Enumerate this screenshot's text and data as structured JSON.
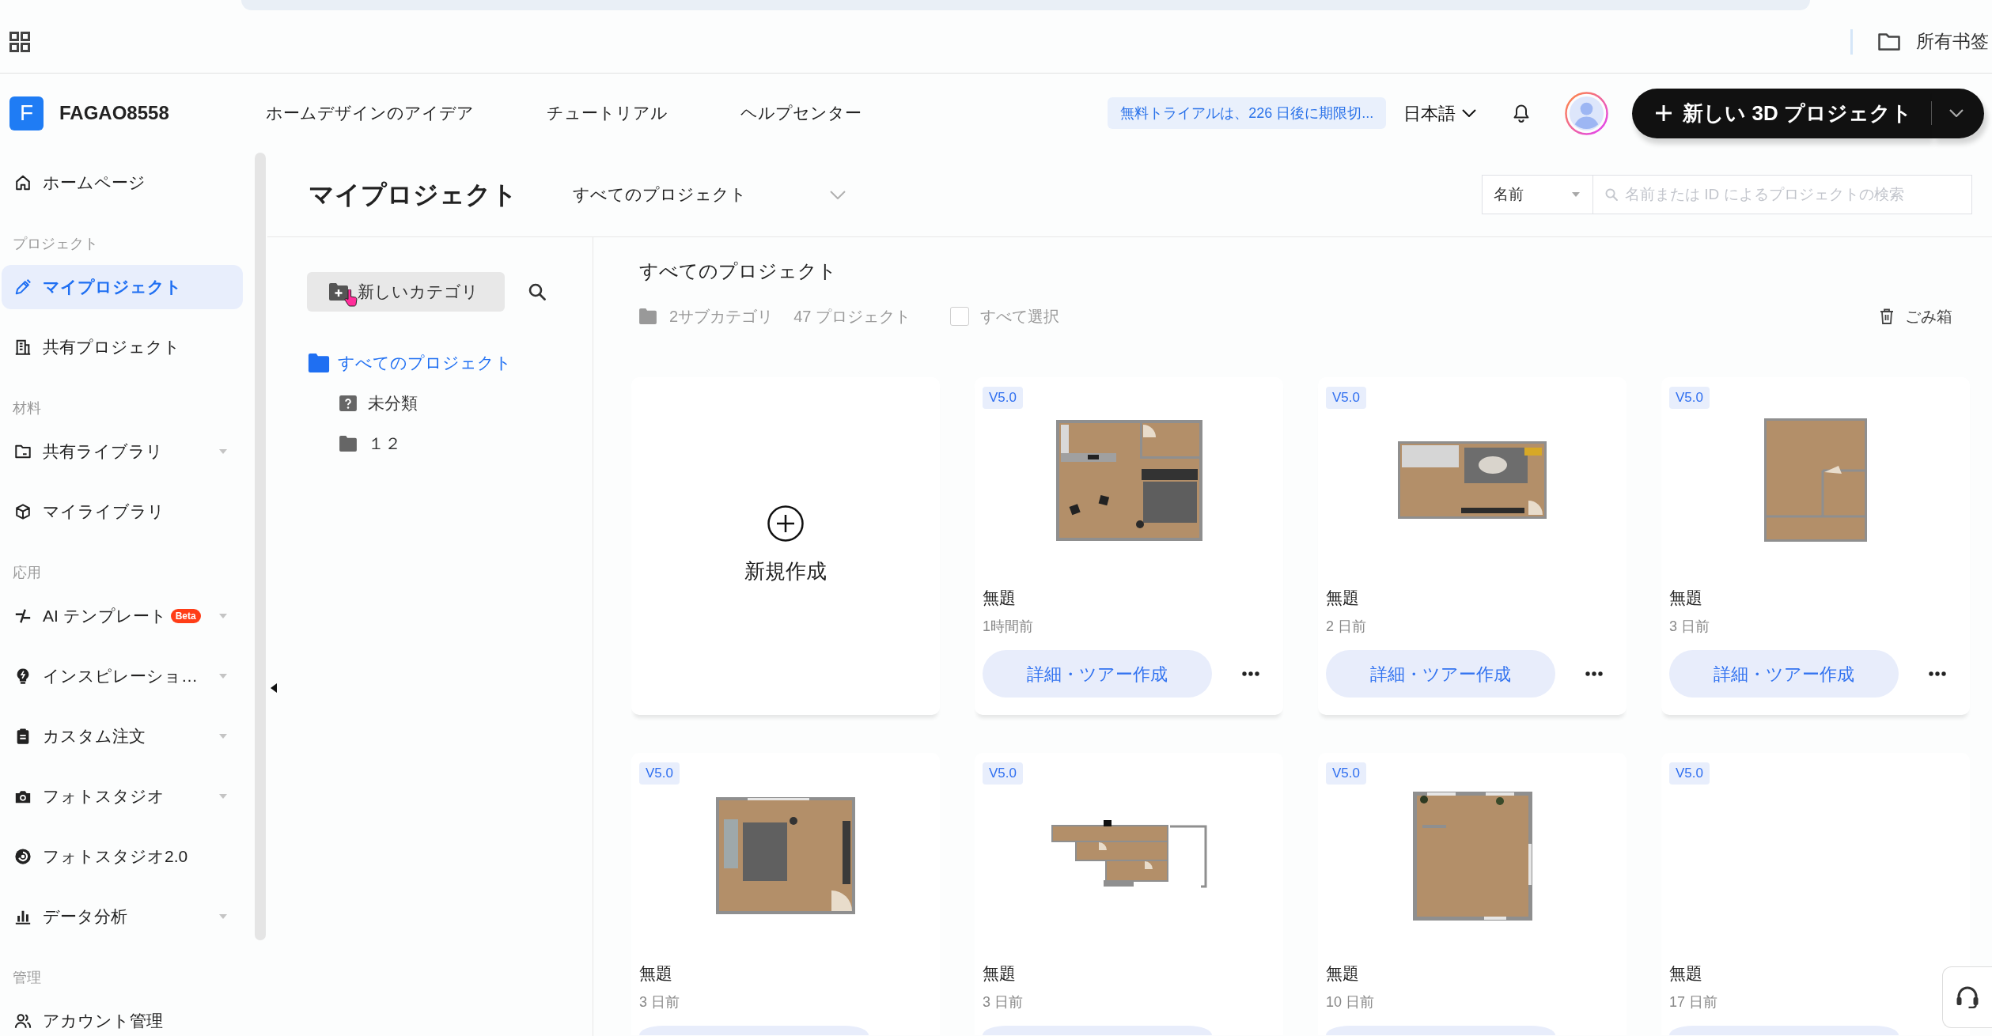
{
  "browser_bar": {
    "bookmarks": "所有书签"
  },
  "header": {
    "logo_letter": "F",
    "account": "FAGAO8558",
    "nav": [
      {
        "label": "ホームデザインのアイデア"
      },
      {
        "label": "チュートリアル"
      },
      {
        "label": "ヘルプセンター"
      }
    ],
    "trial_notice": "無料トライアルは、226 日後に期限切...",
    "language": "日本語",
    "new_project_button": "新しい 3D プロジェクト"
  },
  "sidebar": {
    "groups": [
      {
        "items": [
          {
            "label": "ホームページ",
            "selected": false,
            "expandable": false
          }
        ]
      },
      {
        "title": "プロジェクト",
        "items": [
          {
            "label": "マイプロジェクト",
            "selected": true,
            "expandable": false
          },
          {
            "label": "共有プロジェクト",
            "selected": false,
            "expandable": false
          }
        ]
      },
      {
        "title": "材料",
        "items": [
          {
            "label": "共有ライブラリ",
            "selected": false,
            "expandable": true
          },
          {
            "label": "マイライブラリ",
            "selected": false,
            "expandable": false
          }
        ]
      },
      {
        "title": "応用",
        "items": [
          {
            "label": "AI テンプレート",
            "badge": "Beta",
            "selected": false,
            "expandable": true
          },
          {
            "label": "インスピレーショ…",
            "selected": false,
            "expandable": true
          },
          {
            "label": "カスタム注文",
            "selected": false,
            "expandable": true
          },
          {
            "label": "フォトスタジオ",
            "selected": false,
            "expandable": true
          },
          {
            "label": "フォトスタジオ2.0",
            "selected": false,
            "expandable": false
          },
          {
            "label": "データ分析",
            "selected": false,
            "expandable": true
          }
        ]
      },
      {
        "title": "管理",
        "items": [
          {
            "label": "アカウント管理",
            "selected": false,
            "expandable": false
          }
        ]
      }
    ]
  },
  "page_header": {
    "title": "マイプロジェクト",
    "filter": "すべてのプロジェクト",
    "sort": "名前",
    "search": {
      "placeholder": "名前または ID によるプロジェクトの検索"
    }
  },
  "categories": {
    "new_button": "新しいカテゴリ",
    "tree": [
      {
        "label": "すべてのプロジェクト",
        "kind": "folder",
        "selected": true,
        "children": [
          {
            "label": "未分類",
            "kind": "uncategorized",
            "selected": false
          },
          {
            "label": "１２",
            "kind": "folder",
            "selected": false
          }
        ]
      }
    ]
  },
  "projects": {
    "title": "すべてのプロジェクト",
    "subcategories": "2サブカテゴリ",
    "count": "47 プロジェクト",
    "select_all": {
      "label": "すべて選択",
      "checked": false
    },
    "trash": "ごみ箱",
    "new_card": "新規作成",
    "items": [
      {
        "version": "V5.0",
        "name": "無題",
        "time": "1時間前",
        "action": "詳細・ツアー作成",
        "preview": true
      },
      {
        "version": "V5.0",
        "name": "無題",
        "time": "2 日前",
        "action": "詳細・ツアー作成",
        "preview": true
      },
      {
        "version": "V5.0",
        "name": "無題",
        "time": "3 日前",
        "action": "詳細・ツアー作成",
        "preview": true
      },
      {
        "version": "V5.0",
        "name": "無題",
        "time": "3 日前",
        "preview": true
      },
      {
        "version": "V5.0",
        "name": "無題",
        "time": "3 日前",
        "preview": true
      },
      {
        "version": "V5.0",
        "name": "無題",
        "time": "10 日前",
        "preview": true
      },
      {
        "version": "V5.0",
        "name": "無題",
        "time": "17 日前",
        "preview": false
      }
    ]
  }
}
